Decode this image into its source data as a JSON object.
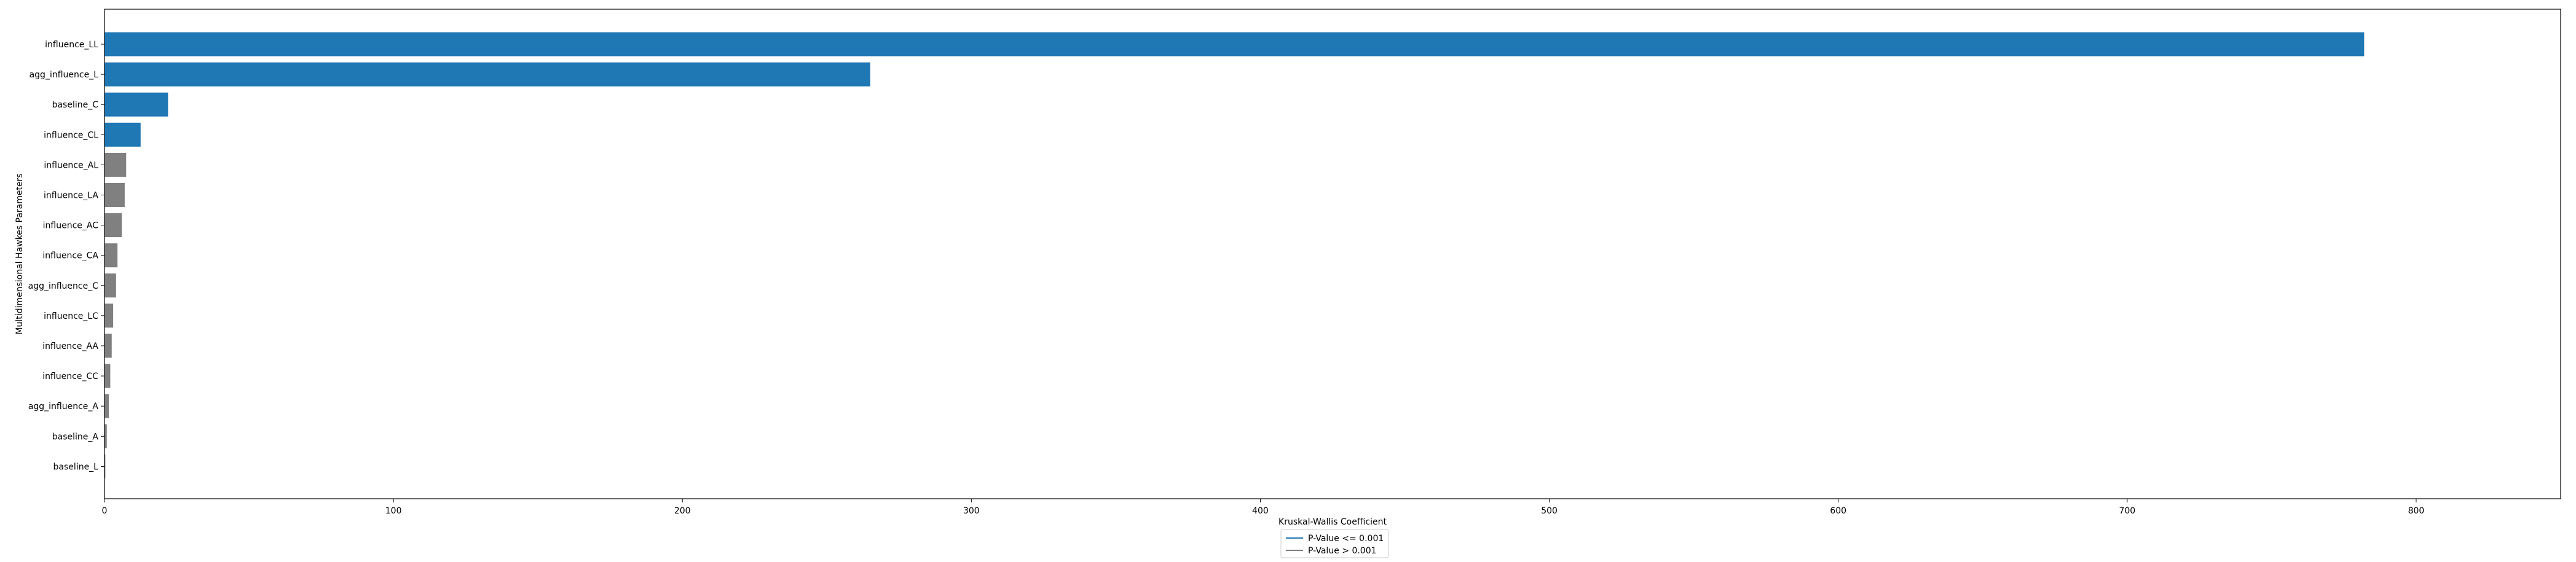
{
  "chart_data": {
    "type": "bar",
    "orientation": "horizontal",
    "xlabel": "Kruskal-Wallis Coefficient",
    "ylabel": "Multidimensional Hawkes Parameters",
    "xlim": [
      0,
      850
    ],
    "xticks": [
      0,
      100,
      200,
      300,
      400,
      500,
      600,
      700,
      800
    ],
    "categories": [
      "influence_LL",
      "agg_influence_L",
      "baseline_C",
      "influence_CL",
      "influence_AL",
      "influence_LA",
      "influence_AC",
      "influence_CA",
      "agg_influence_C",
      "influence_LC",
      "influence_AA",
      "influence_CC",
      "agg_influence_A",
      "baseline_A",
      "baseline_L"
    ],
    "values": [
      782,
      265,
      22,
      12.5,
      7.5,
      7,
      6,
      4.5,
      4,
      3,
      2.5,
      2,
      1.5,
      0.8,
      0.3
    ],
    "significant": [
      true,
      true,
      true,
      true,
      false,
      false,
      false,
      false,
      false,
      false,
      false,
      false,
      false,
      false,
      false
    ],
    "colors": {
      "significant": "#1f77b4",
      "not_significant": "#808080"
    },
    "legend": [
      {
        "label": "P-Value <= 0.001",
        "color": "#1f77b4"
      },
      {
        "label": "P-Value > 0.001",
        "color": "#808080"
      }
    ],
    "legend_position": "bottom-center",
    "grid": false
  }
}
